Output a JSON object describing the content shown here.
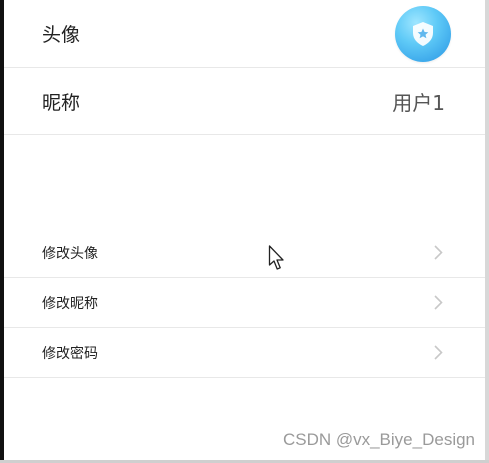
{
  "profile": {
    "avatar_label": "头像",
    "nickname_label": "昵称",
    "nickname_value": "用户1",
    "avatar_icon": "shield-star-icon"
  },
  "menu": {
    "items": [
      {
        "label": "修改头像",
        "icon": "chevron-right-icon"
      },
      {
        "label": "修改昵称",
        "icon": "chevron-right-icon"
      },
      {
        "label": "修改密码",
        "icon": "chevron-right-icon"
      }
    ]
  },
  "watermark": {
    "text": "CSDN @vx_Biye_Design"
  },
  "colors": {
    "avatar_gradient_light": "#9fe6ff",
    "avatar_gradient_dark": "#3a9be3",
    "divider": "#e8e8e8",
    "chevron": "#c8c8c8"
  }
}
